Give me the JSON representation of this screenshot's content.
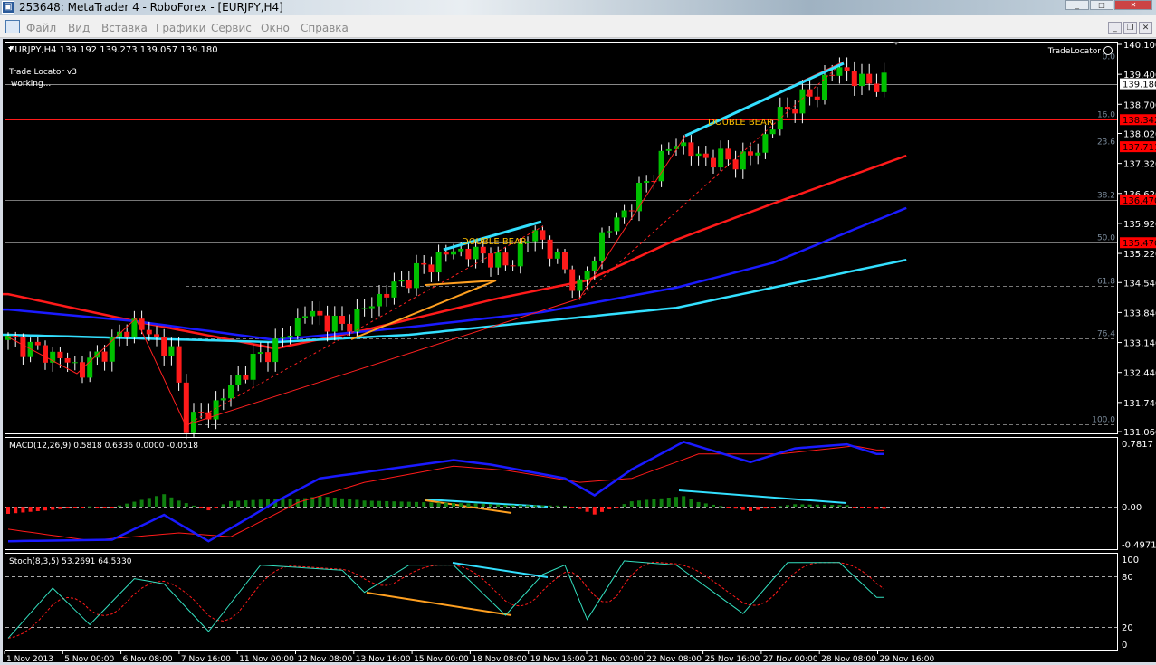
{
  "window": {
    "title": "253648: MetaTrader 4 - RoboForex - [EURJPY,H4]",
    "app_icon": "metatrader-icon"
  },
  "menu": [
    "Файл",
    "Вид",
    "Вставка",
    "Графики",
    "Сервис",
    "Окно",
    "Справка"
  ],
  "chart": {
    "header": "EURJPY,H4  139.192 139.273 139.057 139.180",
    "indicator_name": "Trade Locator v3",
    "indicator_status": "working...",
    "tradelocator_label": "TradeLocator",
    "pattern_labels": [
      "DOUBLE BEAR",
      "DOUBLE BEAR"
    ],
    "current_price": "139.180",
    "colors": {
      "bull": "#00c000",
      "bear": "#ff1a1a",
      "ma_red": "#ff1a1a",
      "ma_blue": "#1a1aff",
      "ma_cyan": "#33e0ff",
      "pattern": "#ffc000",
      "fib_text": "#7a8a9a"
    }
  },
  "chart_data": {
    "type": "candlestick",
    "symbol": "EURJPY",
    "timeframe": "H4",
    "ylim": [
      131.06,
      140.1
    ],
    "price_ticks": [
      "140.100",
      "139.400",
      "138.700",
      "138.020",
      "137.320",
      "136.620",
      "135.920",
      "135.220",
      "134.540",
      "133.840",
      "133.140",
      "132.440",
      "131.740",
      "131.060"
    ],
    "price_markers": [
      {
        "label": "138.342",
        "price": 138.342
      },
      {
        "label": "137.711",
        "price": 137.711
      },
      {
        "label": "136.470",
        "price": 136.47
      },
      {
        "label": "135.470",
        "price": 135.47
      }
    ],
    "fib_levels": [
      {
        "label": "0.0",
        "price": 139.7
      },
      {
        "label": "16.0",
        "price": 138.342
      },
      {
        "label": "23.6",
        "price": 137.711
      },
      {
        "label": "38.2",
        "price": 136.47
      },
      {
        "label": "50.0",
        "price": 135.47
      },
      {
        "label": "61.8",
        "price": 134.47
      },
      {
        "label": "76.4",
        "price": 133.23
      },
      {
        "label": "100.0",
        "price": 131.23
      }
    ],
    "candle_count": 119,
    "close_path": [
      [
        0,
        133.2
      ],
      [
        8,
        132.7
      ],
      [
        10,
        132.5
      ],
      [
        17,
        133.6
      ],
      [
        22,
        132.9
      ],
      [
        24,
        131.3
      ],
      [
        27,
        131.5
      ],
      [
        33,
        132.7
      ],
      [
        37,
        133.2
      ],
      [
        40,
        133.85
      ],
      [
        45,
        133.5
      ],
      [
        50,
        134.2
      ],
      [
        56,
        134.9
      ],
      [
        60,
        135.3
      ],
      [
        65,
        135.15
      ],
      [
        67,
        134.9
      ],
      [
        71,
        135.75
      ],
      [
        72,
        135.5
      ],
      [
        76,
        134.6
      ],
      [
        77,
        134.4
      ],
      [
        80,
        135.6
      ],
      [
        84,
        136.4
      ],
      [
        89,
        137.65
      ],
      [
        90,
        137.85
      ],
      [
        93,
        137.45
      ],
      [
        99,
        137.4
      ],
      [
        101,
        137.65
      ],
      [
        104,
        138.5
      ],
      [
        109,
        139.0
      ],
      [
        112,
        139.6
      ],
      [
        114,
        139.25
      ],
      [
        118,
        139.18
      ]
    ],
    "ma_red": [
      [
        0,
        134.27
      ],
      [
        17,
        133.64
      ],
      [
        36,
        133.0
      ],
      [
        48,
        133.43
      ],
      [
        66,
        134.17
      ],
      [
        78,
        134.59
      ],
      [
        90,
        135.54
      ],
      [
        103,
        136.38
      ],
      [
        121,
        137.5
      ]
    ],
    "ma_blue": [
      [
        0,
        133.91
      ],
      [
        17,
        133.64
      ],
      [
        36,
        133.2
      ],
      [
        54,
        133.5
      ],
      [
        72,
        133.85
      ],
      [
        90,
        134.42
      ],
      [
        103,
        135.0
      ],
      [
        121,
        136.28
      ]
    ],
    "ma_cyan": [
      [
        0,
        133.32
      ],
      [
        36,
        133.15
      ],
      [
        54,
        133.32
      ],
      [
        72,
        133.64
      ],
      [
        90,
        133.95
      ],
      [
        103,
        134.42
      ],
      [
        121,
        135.07
      ]
    ],
    "time_labels": [
      "1 Nov 2013",
      "5 Nov 00:00",
      "6 Nov 08:00",
      "7 Nov 16:00",
      "11 Nov 00:00",
      "12 Nov 08:00",
      "13 Nov 16:00",
      "15 Nov 00:00",
      "18 Nov 08:00",
      "19 Nov 16:00",
      "21 Nov 00:00",
      "22 Nov 08:00",
      "25 Nov 16:00",
      "27 Nov 00:00",
      "28 Nov 08:00",
      "29 Nov 16:00"
    ],
    "macd": {
      "label": "MACD(12,26,9) 0.5818 0.6336 0.0000 -0.0518",
      "ticks": [
        "0.7817",
        "0.00",
        "-0.4971"
      ],
      "ylim": [
        -0.4971,
        0.7817
      ],
      "main": [
        [
          0,
          -0.46
        ],
        [
          14,
          -0.44
        ],
        [
          21,
          -0.11
        ],
        [
          27,
          -0.46
        ],
        [
          36,
          0.06
        ],
        [
          42,
          0.35
        ],
        [
          60,
          0.575
        ],
        [
          65,
          0.52
        ],
        [
          75,
          0.35
        ],
        [
          79,
          0.14
        ],
        [
          84,
          0.46
        ],
        [
          91,
          0.8
        ],
        [
          100,
          0.55
        ],
        [
          106,
          0.72
        ],
        [
          113,
          0.77
        ],
        [
          117,
          0.65
        ]
      ],
      "signal": [
        [
          0,
          -0.3
        ],
        [
          11,
          -0.45
        ],
        [
          23,
          -0.35
        ],
        [
          30,
          -0.4
        ],
        [
          39,
          0.05
        ],
        [
          48,
          0.3
        ],
        [
          60,
          0.5
        ],
        [
          67,
          0.45
        ],
        [
          77,
          0.3
        ],
        [
          84,
          0.35
        ],
        [
          93,
          0.65
        ],
        [
          104,
          0.65
        ],
        [
          114,
          0.75
        ],
        [
          117,
          0.7
        ]
      ]
    },
    "stoch": {
      "label": "Stoch(8,3,5) 53.2691 64.5330",
      "ticks": [
        "100",
        "80",
        "20",
        "0"
      ],
      "ylim": [
        0,
        100
      ],
      "main": [
        [
          0,
          7
        ],
        [
          6,
          66
        ],
        [
          11,
          23
        ],
        [
          17,
          77
        ],
        [
          21,
          71
        ],
        [
          27,
          15
        ],
        [
          34,
          93
        ],
        [
          45,
          87
        ],
        [
          48,
          61
        ],
        [
          54,
          93
        ],
        [
          60,
          93
        ],
        [
          67,
          34
        ],
        [
          72,
          82
        ],
        [
          75,
          93
        ],
        [
          78,
          29
        ],
        [
          83,
          98
        ],
        [
          90,
          93
        ],
        [
          99,
          36
        ],
        [
          105,
          96
        ],
        [
          112,
          96
        ],
        [
          117,
          55
        ]
      ]
    }
  }
}
